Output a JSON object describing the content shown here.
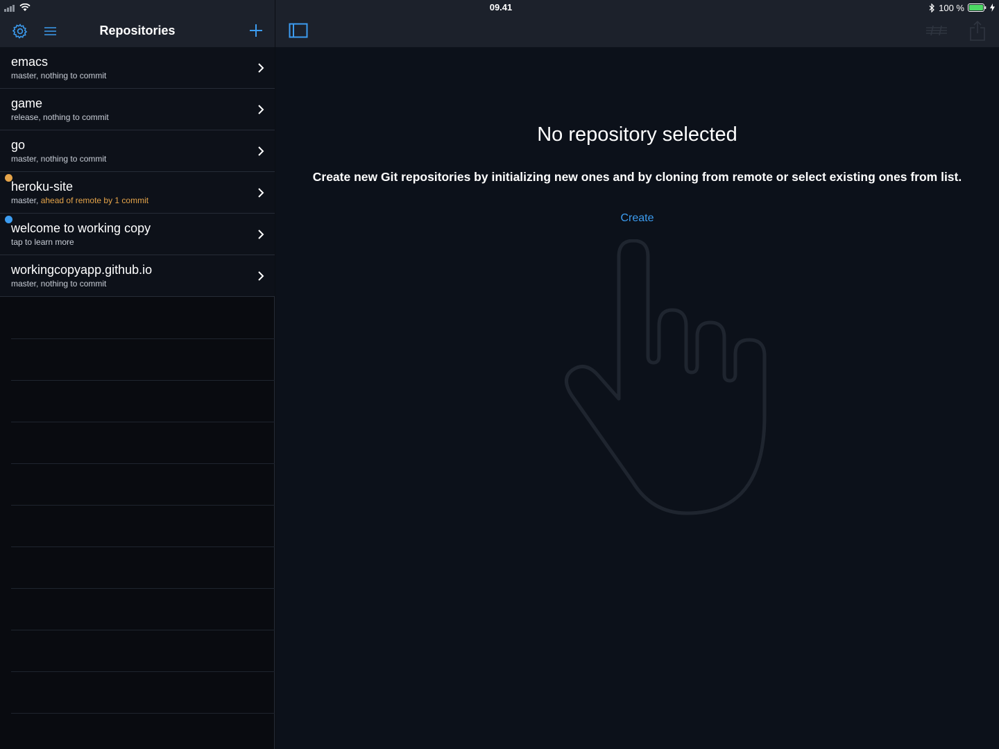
{
  "status_bar": {
    "time": "09.41",
    "battery_text": "100 %"
  },
  "sidebar": {
    "title": "Repositories",
    "icons": [
      "gear-icon",
      "menu-icon",
      "plus-icon"
    ],
    "repositories": [
      {
        "name": "emacs",
        "status": "master, nothing to commit",
        "status_prefix": "",
        "status_highlight": "",
        "badge": ""
      },
      {
        "name": "game",
        "status": "release, nothing to commit",
        "status_prefix": "",
        "status_highlight": "",
        "badge": ""
      },
      {
        "name": "go",
        "status": "master, nothing to commit",
        "status_prefix": "",
        "status_highlight": "",
        "badge": ""
      },
      {
        "name": "heroku-site",
        "status": "",
        "status_prefix": "master, ",
        "status_highlight": "ahead of remote by 1 commit",
        "badge": "orange"
      },
      {
        "name": "welcome to working copy",
        "status": "tap to learn more",
        "status_prefix": "",
        "status_highlight": "",
        "badge": "blue"
      },
      {
        "name": "workingcopyapp.github.io",
        "status": "master, nothing to commit",
        "status_prefix": "",
        "status_highlight": "",
        "badge": ""
      }
    ]
  },
  "detail": {
    "toolbar_icons": [
      "sidebar-toggle-icon",
      "sliders-icon",
      "share-icon"
    ],
    "empty_title": "No repository selected",
    "empty_message": "Create new Git repositories by initializing new ones and by cloning from remote or select existing ones from list.",
    "create_label": "Create",
    "illustration": "pointing-hand-icon"
  },
  "colors": {
    "accent": "#3c9cf0",
    "warning": "#e5a44a",
    "header_bg": "#1c212b",
    "battery": "#4cd964"
  }
}
